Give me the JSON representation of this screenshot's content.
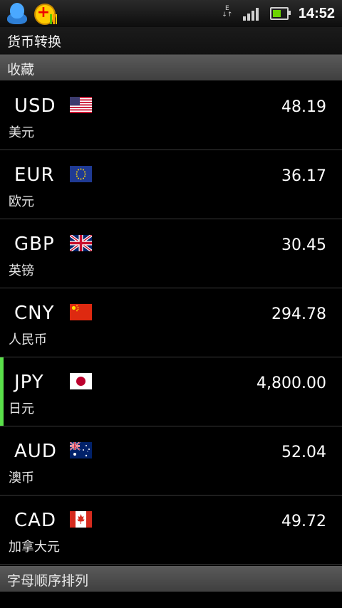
{
  "status_bar": {
    "time": "14:52",
    "network_type": "E",
    "icons": [
      "qq-icon",
      "plus-app-icon",
      "data-arrows-icon",
      "signal-icon",
      "battery-icon"
    ]
  },
  "title": "货币转换",
  "sections": {
    "favorites": "收藏",
    "alphabetical": "字母顺序排列"
  },
  "currencies": [
    {
      "code": "USD",
      "name": "美元",
      "amount": "48.19",
      "flag": "us-flag-icon"
    },
    {
      "code": "EUR",
      "name": "欧元",
      "amount": "36.17",
      "flag": "eu-flag-icon"
    },
    {
      "code": "GBP",
      "name": "英镑",
      "amount": "30.45",
      "flag": "uk-flag-icon"
    },
    {
      "code": "CNY",
      "name": "人民币",
      "amount": "294.78",
      "flag": "china-flag-icon"
    },
    {
      "code": "JPY",
      "name": "日元",
      "amount": "4,800.00",
      "flag": "japan-flag-icon",
      "selected": true
    },
    {
      "code": "AUD",
      "name": "澳币",
      "amount": "52.04",
      "flag": "australia-flag-icon"
    },
    {
      "code": "CAD",
      "name": "加拿大元",
      "amount": "49.72",
      "flag": "canada-flag-icon"
    }
  ],
  "colors": {
    "selected_indicator": "#5ae04a",
    "background": "#000000",
    "section_header": "#4a4a4a"
  }
}
